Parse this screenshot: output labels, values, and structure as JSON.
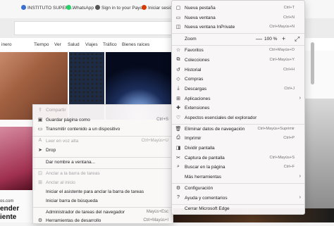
{
  "bookmarks": [
    {
      "label": "INSTITUTO SUPERI...",
      "icon": "bookmark-icon",
      "color": "#3a6fd0"
    },
    {
      "label": "WhatsApp",
      "icon": "whatsapp-icon",
      "color": "#25d366"
    },
    {
      "label": "Sign in to your Payo...",
      "icon": "globe-icon",
      "color": "#555555"
    },
    {
      "label": "Iniciar sesión -",
      "icon": "office-icon",
      "color": "#d83b01"
    }
  ],
  "news_nav": [
    "inero",
    "Tiempo",
    "Ver",
    "Salud",
    "Viajes",
    "Tráfico",
    "Bienes raíces"
  ],
  "page": {
    "left_caption": "os.com",
    "headline_1": "ender",
    "headline_2": "iente"
  },
  "context_menu": {
    "items": [
      {
        "label": "Compartir",
        "icon": "share-icon",
        "shortcut": "",
        "disabled": true
      },
      {
        "label": "Guardar página como",
        "icon": "save-icon",
        "shortcut": "Ctrl+S",
        "disabled": false
      },
      {
        "label": "Transmitir contenido a un dispositivo",
        "icon": "cast-icon",
        "shortcut": "",
        "disabled": false
      },
      {
        "label": "Leer en voz alta",
        "icon": "read-aloud-icon",
        "shortcut": "Ctrl+Mayús+U",
        "disabled": true
      },
      {
        "label": "Drop",
        "icon": "drop-icon",
        "shortcut": "",
        "disabled": false
      },
      {
        "label": "Dar nombre a ventana...",
        "icon": "",
        "shortcut": "",
        "disabled": false
      },
      {
        "label": "Anclar a la barra de tareas",
        "icon": "pin-icon",
        "shortcut": "",
        "disabled": true
      },
      {
        "label": "Anclar al inicio",
        "icon": "pin-start-icon",
        "shortcut": "",
        "disabled": true
      },
      {
        "label": "Iniciar el asistente para anclar la barra de tareas",
        "icon": "",
        "shortcut": "",
        "disabled": false
      },
      {
        "label": "Iniciar barra de búsqueda",
        "icon": "",
        "shortcut": "",
        "disabled": false
      },
      {
        "label": "Administrador de tareas del navegador",
        "icon": "",
        "shortcut": "Mayús+Esc",
        "disabled": false
      },
      {
        "label": "Herramientas de desarrollo",
        "icon": "devtools-icon",
        "shortcut": "Ctrl+Mayús+I",
        "disabled": false
      }
    ]
  },
  "edge_menu": {
    "items": [
      {
        "label": "Nueva pestaña",
        "icon": "new-tab-icon",
        "shortcut": "Ctrl+T"
      },
      {
        "label": "Nueva ventana",
        "icon": "new-window-icon",
        "shortcut": "Ctrl+N"
      },
      {
        "label": "Nueva ventana InPrivate",
        "icon": "inprivate-icon",
        "shortcut": "Ctrl+Mayús+N"
      }
    ],
    "zoom": {
      "label": "Zoom",
      "value": "100 %",
      "minus": "—",
      "plus": "+",
      "fullscreen": "⤢"
    },
    "items2": [
      {
        "label": "Favoritos",
        "icon": "favorites-icon",
        "shortcut": "Ctrl+Mayús+O"
      },
      {
        "label": "Colecciones",
        "icon": "collections-icon",
        "shortcut": "Ctrl+Mayús+Y"
      },
      {
        "label": "Historial",
        "icon": "history-icon",
        "shortcut": "Ctrl+H"
      },
      {
        "label": "Compras",
        "icon": "shopping-icon",
        "shortcut": ""
      },
      {
        "label": "Descargas",
        "icon": "downloads-icon",
        "shortcut": "Ctrl+J"
      },
      {
        "label": "Aplicaciones",
        "icon": "apps-icon",
        "shortcut": "",
        "submenu": true
      },
      {
        "label": "Extensiones",
        "icon": "extensions-icon",
        "shortcut": ""
      },
      {
        "label": "Aspectos esenciales del explorador",
        "icon": "essentials-icon",
        "shortcut": ""
      },
      {
        "label": "Eliminar datos de navegación",
        "icon": "delete-data-icon",
        "shortcut": "Ctrl+Mayús+Suprimir"
      },
      {
        "label": "Imprimir",
        "icon": "print-icon",
        "shortcut": "Ctrl+P"
      },
      {
        "label": "Dividir pantalla",
        "icon": "split-screen-icon",
        "shortcut": ""
      },
      {
        "label": "Captura de pantalla",
        "icon": "screenshot-icon",
        "shortcut": "Ctrl+Mayús+S"
      },
      {
        "label": "Buscar en la página",
        "icon": "find-icon",
        "shortcut": "Ctrl+F"
      },
      {
        "label": "Más herramientas",
        "icon": "",
        "shortcut": "",
        "submenu": true
      },
      {
        "label": "Configuración",
        "icon": "settings-icon",
        "shortcut": ""
      },
      {
        "label": "Ayuda y comentarios",
        "icon": "help-icon",
        "shortcut": "",
        "submenu": true
      },
      {
        "label": "Cerrar Microsoft Edge",
        "icon": "",
        "shortcut": ""
      }
    ]
  }
}
